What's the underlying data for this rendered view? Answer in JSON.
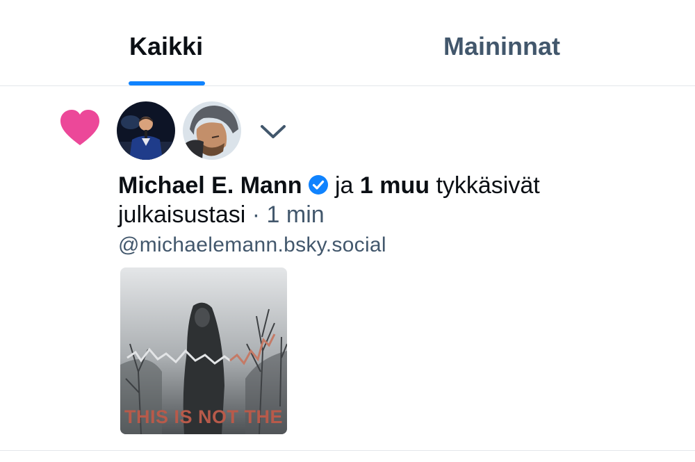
{
  "tabs": [
    {
      "label": "Kaikki",
      "active": true
    },
    {
      "label": "Maininnat",
      "active": false
    }
  ],
  "notification": {
    "icon": "heart-icon",
    "heart_color": "#ec4899",
    "verified_color": "#1083fe",
    "actor_name": "Michael E. Mann",
    "connector": "ja",
    "others": "1 muu",
    "action": "tykkäsivät julkaisustasi",
    "separator": "·",
    "time": "1 min",
    "handle": "@michaelemann.bsky.social",
    "post_image_text": "THIS IS NOT THE"
  }
}
